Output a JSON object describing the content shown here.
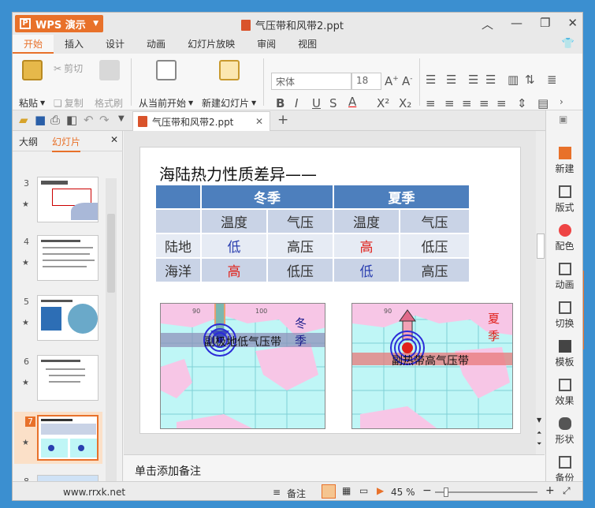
{
  "app": {
    "menu_label": "WPS 演示",
    "doc_title": "气压带和风带2.ppt"
  },
  "tabs": [
    {
      "label": "开始",
      "active": true
    },
    {
      "label": "插入"
    },
    {
      "label": "设计"
    },
    {
      "label": "动画"
    },
    {
      "label": "幻灯片放映"
    },
    {
      "label": "审阅"
    },
    {
      "label": "视图"
    }
  ],
  "ribbon": {
    "paste": "粘贴",
    "cut": "剪切",
    "copy": "复制",
    "format_painter": "格式刷",
    "from_current": "从当前开始",
    "new_slide": "新建幻灯片",
    "font_name": "宋体",
    "font_size": "18"
  },
  "doc_tab": {
    "label": "气压带和风带2.ppt"
  },
  "left_pane": {
    "tab_outline": "大纲",
    "tab_slides": "幻灯片",
    "thumbs": [
      "3",
      "4",
      "5",
      "6",
      "7",
      "8"
    ],
    "selected": "7"
  },
  "slide": {
    "title": "海陆热力性质差异——",
    "table": {
      "season_winter": "冬季",
      "season_summer": "夏季",
      "h_temp": "温度",
      "h_press": "气压",
      "rows": [
        {
          "label": "陆地",
          "w_temp": "低",
          "w_press": "高压",
          "s_temp": "高",
          "s_press": "低压"
        },
        {
          "label": "海洋",
          "w_temp": "高",
          "w_press": "低压",
          "s_temp": "低",
          "s_press": "高压"
        }
      ]
    },
    "map_left": {
      "band_label": "副极地低气压带",
      "season": "冬季"
    },
    "map_right": {
      "band_label": "副热带高气压带",
      "season": "夏季"
    },
    "map_ticks": {
      "left": [
        "90",
        "100"
      ],
      "right": [
        "90"
      ]
    }
  },
  "notes": {
    "placeholder": "单击添加备注"
  },
  "right_pane": [
    "新建",
    "版式",
    "配色",
    "动画",
    "切换",
    "模板",
    "效果",
    "形状",
    "备份"
  ],
  "status": {
    "site": "www.rrxk.net",
    "notes_label": "备注",
    "zoom": "45 %"
  },
  "colors": {
    "accent": "#e8712a",
    "header_blue": "#4d7fbd",
    "low_blue": "#2b3fb0",
    "high_red": "#e0201a"
  }
}
